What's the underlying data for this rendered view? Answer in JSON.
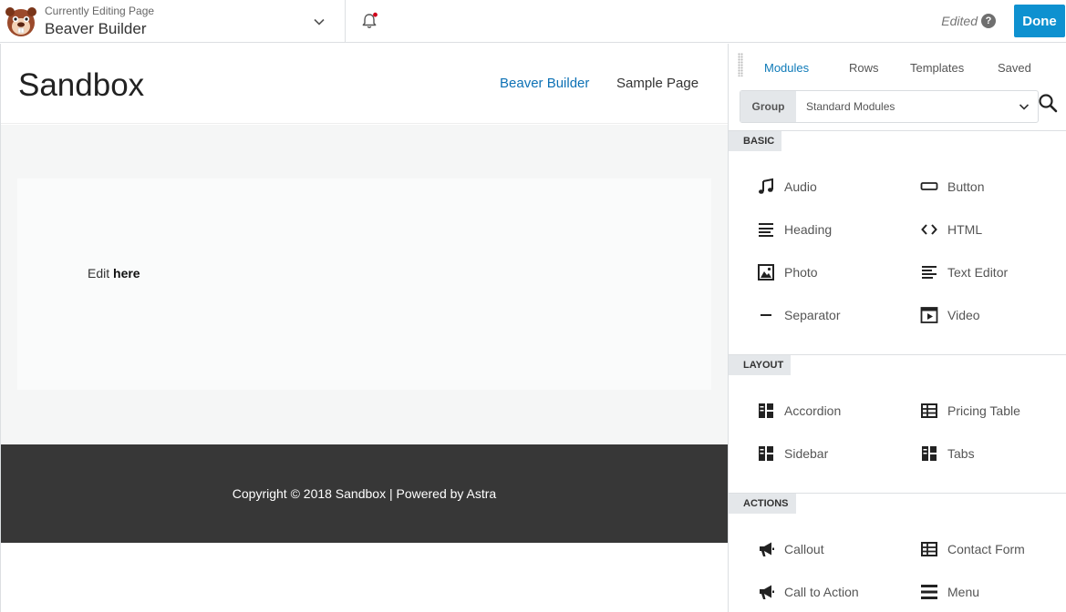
{
  "topbar": {
    "subtitle": "Currently Editing Page",
    "title": "Beaver Builder",
    "status": "Edited",
    "help": "?",
    "done_label": "Done"
  },
  "site": {
    "title": "Sandbox",
    "nav": [
      "Beaver Builder",
      "Sample Page"
    ],
    "edit_text_prefix": "Edit ",
    "edit_text_bold": "here",
    "footer": "Copyright © 2018 Sandbox | Powered by Astra"
  },
  "panel": {
    "tabs": [
      "Modules",
      "Rows",
      "Templates",
      "Saved"
    ],
    "active_tab": "Modules",
    "group_label": "Group",
    "group_value": "Standard Modules",
    "sections": [
      {
        "label": "BASIC",
        "modules": [
          {
            "label": "Audio",
            "icon": "music-icon"
          },
          {
            "label": "Button",
            "icon": "button-icon"
          },
          {
            "label": "Heading",
            "icon": "heading-icon"
          },
          {
            "label": "HTML",
            "icon": "code-icon"
          },
          {
            "label": "Photo",
            "icon": "photo-icon"
          },
          {
            "label": "Text Editor",
            "icon": "text-editor-icon"
          },
          {
            "label": "Separator",
            "icon": "separator-icon"
          },
          {
            "label": "Video",
            "icon": "video-icon"
          }
        ]
      },
      {
        "label": "LAYOUT",
        "modules": [
          {
            "label": "Accordion",
            "icon": "accordion-icon"
          },
          {
            "label": "Pricing Table",
            "icon": "table-icon"
          },
          {
            "label": "Sidebar",
            "icon": "sidebar-icon"
          },
          {
            "label": "Tabs",
            "icon": "tabs-icon"
          }
        ]
      },
      {
        "label": "ACTIONS",
        "modules": [
          {
            "label": "Callout",
            "icon": "megaphone-icon"
          },
          {
            "label": "Contact Form",
            "icon": "form-icon"
          },
          {
            "label": "Call to Action",
            "icon": "megaphone-icon"
          },
          {
            "label": "Menu",
            "icon": "menu-icon"
          }
        ]
      }
    ]
  },
  "colors": {
    "accent": "#0e91d0",
    "tab_active": "#0e7ab8",
    "link": "#0d71b5",
    "footer_bg": "#373737",
    "notification_dot": "#d0021b"
  }
}
